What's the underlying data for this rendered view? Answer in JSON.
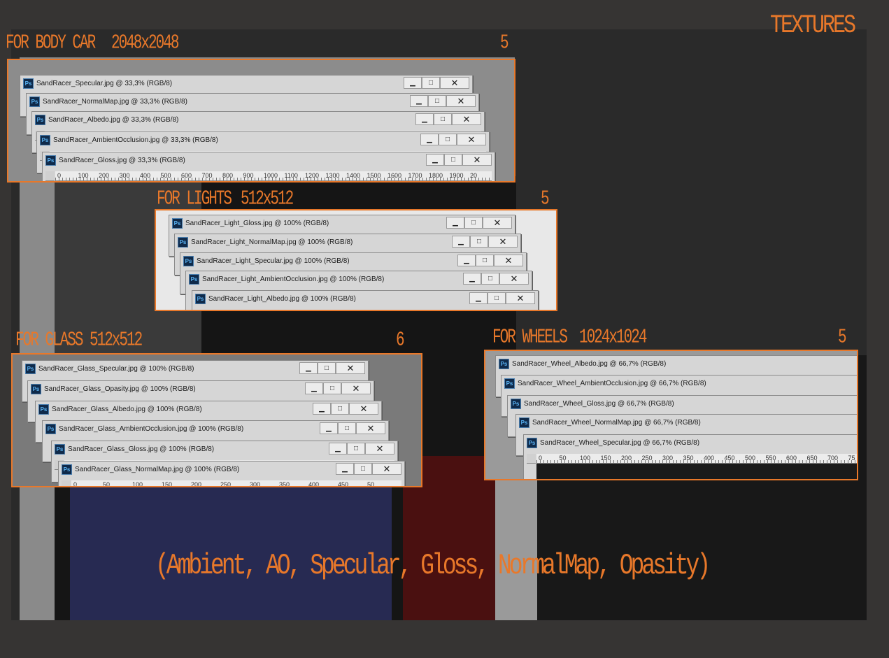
{
  "header": {
    "title": "TEXTURES"
  },
  "caption": "(Ambient, AO, Specular, Gloss, NormalMap, Opasity)",
  "ruler_body": [
    "0",
    "100",
    "200",
    "300",
    "400",
    "500",
    "600",
    "700",
    "800",
    "900",
    "1000",
    "1100",
    "1200",
    "1300",
    "1400",
    "1500",
    "1600",
    "1700",
    "1800",
    "1900",
    "20"
  ],
  "ruler_small": [
    "0",
    "50",
    "100",
    "150",
    "200",
    "250",
    "300",
    "350",
    "400",
    "450",
    "50"
  ],
  "ruler_wheel": [
    "0",
    "50",
    "100",
    "150",
    "200",
    "250",
    "300",
    "350",
    "400",
    "450",
    "500",
    "550",
    "600",
    "650",
    "700",
    "75"
  ],
  "window_buttons": {
    "minimize": "▁",
    "maximize": "□",
    "close": "✕"
  },
  "groups": {
    "body": {
      "label": "FOR BODY CAR",
      "size": "2048x2048",
      "count": "5",
      "windows": [
        "SandRacer_Specular.jpg @ 33,3% (RGB/8)",
        "SandRacer_NormalMap.jpg @ 33,3% (RGB/8)",
        "SandRacer_Albedo.jpg @ 33,3% (RGB/8)",
        "SandRacer_AmbientOcclusion.jpg @ 33,3% (RGB/8)",
        "SandRacer_Gloss.jpg @ 33,3% (RGB/8)"
      ]
    },
    "lights": {
      "label": "FOR LIGHTS",
      "size": "512x512",
      "count": "5",
      "windows": [
        "SandRacer_Light_Gloss.jpg @ 100% (RGB/8)",
        "SandRacer_Light_NormalMap.jpg @ 100% (RGB/8)",
        "SandRacer_Light_Specular.jpg @ 100% (RGB/8)",
        "SandRacer_Light_AmbientOcclusion.jpg @ 100% (RGB/8)",
        "SandRacer_Light_Albedo.jpg @ 100% (RGB/8)"
      ]
    },
    "glass": {
      "label": "FOR GLASS",
      "size": "512x512",
      "count": "6",
      "windows": [
        "SandRacer_Glass_Specular.jpg @ 100% (RGB/8)",
        "SandRacer_Glass_Opasity.jpg @ 100% (RGB/8)",
        "SandRacer_Glass_Albedo.jpg @ 100% (RGB/8)",
        "SandRacer_Glass_AmbientOcclusion.jpg @ 100% (RGB/8)",
        "SandRacer_Glass_Gloss.jpg @ 100% (RGB/8)",
        "SandRacer_Glass_NormalMap.jpg @ 100% (RGB/8)"
      ]
    },
    "wheels": {
      "label": "FOR WHEELS",
      "size": "1024x1024",
      "count": "5",
      "windows": [
        "SandRacer_Wheel_Albedo.jpg @ 66,7% (RGB/8)",
        "SandRacer_Wheel_AmbientOcclusion.jpg @ 66,7% (RGB/8)",
        "SandRacer_Wheel_Gloss.jpg @ 66,7% (RGB/8)",
        "SandRacer_Wheel_NormalMap.jpg @ 66,7% (RGB/8)",
        "SandRacer_Wheel_Specular.jpg @ 66,7% (RGB/8)"
      ]
    }
  }
}
